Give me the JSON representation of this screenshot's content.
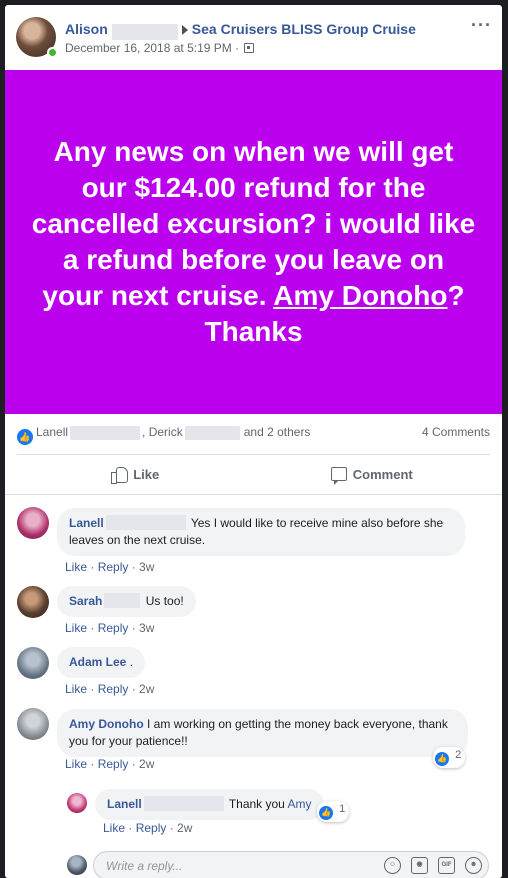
{
  "post": {
    "author_first": "Alison",
    "group": "Sea Cruisers BLISS Group Cruise",
    "timestamp": "December 16, 2018 at 5:19 PM",
    "more_icon": "ellipsis-icon",
    "privacy_icon": "group-privacy-icon",
    "status_background": "#bb00ee",
    "status_text_before": "Any news on when we will get our $124.00 refund for the cancelled excursion? i would like a refund before you leave on your next cruise.",
    "status_mention": "Amy Donoho",
    "status_text_after": "? Thanks"
  },
  "reactions": {
    "name1": "Lanell",
    "name2": "Derick",
    "others": "and 2 others",
    "comment_count": "4 Comments"
  },
  "actions": {
    "like": "Like",
    "comment": "Comment"
  },
  "comments": [
    {
      "name": "Lanell",
      "text": "Yes I would like to receive mine also before she leaves on the next cruise.",
      "like": "Like",
      "reply": "Reply",
      "time": "3w"
    },
    {
      "name": "Sarah",
      "text": "Us too!",
      "like": "Like",
      "reply": "Reply",
      "time": "3w"
    },
    {
      "name": "Adam Lee",
      "text": ".",
      "like": "Like",
      "reply": "Reply",
      "time": "2w"
    },
    {
      "name": "Amy Donoho",
      "text": "I am working on getting the money back everyone, thank you for your patience!!",
      "like": "Like",
      "reply": "Reply",
      "time": "2w",
      "reaction_count": "2"
    },
    {
      "name": "Lanell",
      "text": "Thank you",
      "mention": "Amy",
      "like": "Like",
      "reply": "Reply",
      "time": "2w",
      "reaction_count": "1"
    }
  ],
  "reply_box": {
    "placeholder": "Write a reply...",
    "icons": [
      "emoji-icon",
      "camera-icon",
      "gif-icon",
      "sticker-icon"
    ],
    "gif_label": "GIF"
  },
  "colors": {
    "link": "#385898",
    "like_blue": "#1877f2",
    "online": "#42b72a"
  }
}
